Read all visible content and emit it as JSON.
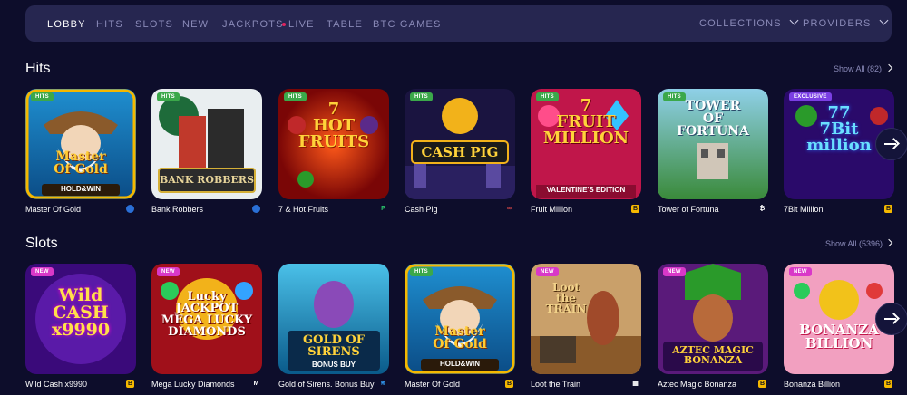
{
  "nav": {
    "items": [
      "LOBBY",
      "HITS",
      "SLOTS",
      "NEW",
      "JACKPOTS",
      "LIVE",
      "TABLE",
      "BTC GAMES"
    ],
    "collections": "COLLECTIONS",
    "providers": "PROVIDERS"
  },
  "hits": {
    "title": "Hits",
    "show_all": "Show All (82)",
    "games": [
      {
        "name": "Master Of Gold",
        "badge": "HITS",
        "art": "Master\nOf Gold",
        "sub": "HOLD&WIN",
        "currency": "coin"
      },
      {
        "name": "Bank Robbers",
        "badge": "HITS",
        "art": "BANK ROBBERS",
        "sub": "",
        "currency": "coin"
      },
      {
        "name": "7 & Hot Fruits",
        "badge": "HITS",
        "art": "7\nHOT\nFRUITS",
        "sub": "",
        "currency": "P"
      },
      {
        "name": "Cash Pig",
        "badge": "HITS",
        "art": "CASH PIG",
        "sub": "",
        "currency": "link"
      },
      {
        "name": "Fruit Million",
        "badge": "HITS",
        "art": "7\nFRUIT\nMILLION",
        "sub": "VALENTINE'S EDITION",
        "currency": "B"
      },
      {
        "name": "Tower of Fortuna",
        "badge": "HITS",
        "art": "TOWER\nOF\nFORTUNA",
        "sub": "",
        "currency": "B"
      },
      {
        "name": "7Bit Million",
        "badge": "EXCLUSIVE",
        "art": "77\n7Bit\nmillion",
        "sub": "",
        "currency": "B"
      }
    ]
  },
  "slots": {
    "title": "Slots",
    "show_all": "Show All (5396)",
    "games": [
      {
        "name": "Wild Cash x9990",
        "badge": "NEW",
        "art": "Wild\nCASH\nx9990",
        "sub": "",
        "currency": "B"
      },
      {
        "name": "Mega Lucky Diamonds",
        "badge": "NEW",
        "art": "Lucky\nJACKPOT\nMEGA LUCKY\nDIAMONDS",
        "sub": "",
        "currency": "M"
      },
      {
        "name": "Gold of Sirens. Bonus Buy",
        "badge": "",
        "art": "GOLD OF\nSIRENS",
        "sub": "BONUS BUY",
        "currency": "S"
      },
      {
        "name": "Master Of Gold",
        "badge": "HITS",
        "art": "Master\nOf Gold",
        "sub": "HOLD&WIN",
        "currency": "B"
      },
      {
        "name": "Loot the Train",
        "badge": "NEW",
        "art": "Loot\nthe TRAIN",
        "sub": "",
        "currency": "Q"
      },
      {
        "name": "Aztec Magic Bonanza",
        "badge": "NEW",
        "art": "AZTEC MAGIC\nBONANZA",
        "sub": "",
        "currency": "B"
      },
      {
        "name": "Bonanza Billion",
        "badge": "NEW",
        "art": "BONANZA\nBILLION",
        "sub": "",
        "currency": "B"
      }
    ]
  },
  "colors": {
    "bg": "#0d0d2b",
    "nav": "#262650",
    "accent": "#f5b800"
  }
}
